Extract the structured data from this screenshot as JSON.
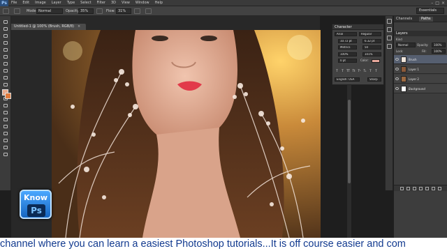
{
  "app": {
    "logo_text": "Ps"
  },
  "menu": [
    "File",
    "Edit",
    "Image",
    "Layer",
    "Type",
    "Select",
    "Filter",
    "3D",
    "View",
    "Window",
    "Help"
  ],
  "options_bar": {
    "mode_label": "Mode:",
    "mode_value": "Normal",
    "opacity_label": "Opacity:",
    "opacity_value": "35%",
    "flow_label": "Flow:",
    "flow_value": "31%",
    "workspace": "Essentials"
  },
  "document": {
    "tab_title": "Untitled-1 @ 100% (Brush, RGB/8)",
    "close_glyph": "×"
  },
  "character_panel": {
    "title": "Character",
    "font_family": "Arial",
    "font_style": "Regular",
    "size": "10.72 pt",
    "leading": "6.32 pt",
    "kerning": "Metrics",
    "tracking": "50",
    "vscale": "100%",
    "hscale": "101%",
    "baseline": "0 pt",
    "color_label": "Color:",
    "language": "English: USA",
    "antialias": "Sharp",
    "type_buttons": [
      "T",
      "T",
      "TT",
      "Tt",
      "T¹",
      "T₁",
      "T",
      "T"
    ]
  },
  "right_panel": {
    "tabs": [
      "Channels",
      "Paths"
    ],
    "layers_title": "Layers",
    "kind_label": "Kind",
    "blend_mode": "Normal",
    "opacity_label": "Opacity:",
    "opacity": "100%",
    "lock_label": "Lock:",
    "fill_label": "Fill:",
    "fill": "100%",
    "layers": [
      {
        "name": "Brush",
        "selected": true,
        "italic": false
      },
      {
        "name": "Layer 1",
        "selected": false,
        "italic": false
      },
      {
        "name": "Layer 2",
        "selected": false,
        "italic": false
      },
      {
        "name": "Background",
        "selected": false,
        "italic": true
      }
    ]
  },
  "colors": {
    "foreground": "#e8a98c",
    "background": "#e07a3c",
    "accent_blue": "#4aa8ff"
  },
  "watermark": {
    "line1": "Know",
    "line2": "Ps"
  },
  "ticker": "channel where you can learn a easiest Photoshop tutorials...It is off course easier and com"
}
